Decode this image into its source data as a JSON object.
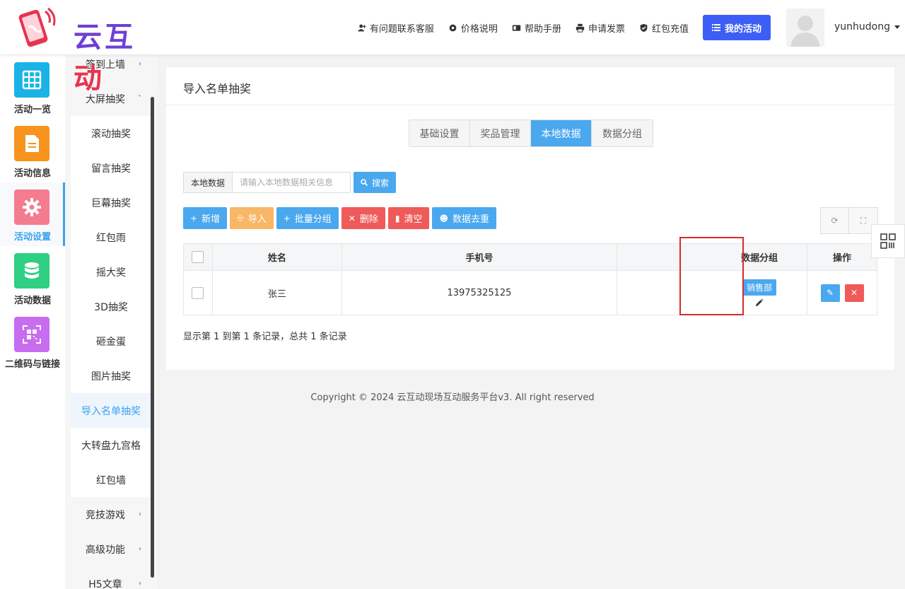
{
  "header": {
    "logo_text_a": "云互",
    "logo_text_b": "动",
    "nav": [
      {
        "label": "有问题联系客服",
        "icon": "user-plus-icon"
      },
      {
        "label": "价格说明",
        "icon": "gear-icon"
      },
      {
        "label": "帮助手册",
        "icon": "book-icon"
      },
      {
        "label": "申请发票",
        "icon": "printer-icon"
      },
      {
        "label": "红包充值",
        "icon": "shield-check-icon"
      }
    ],
    "my_activity_label": "我的活动",
    "username": "yunhudong"
  },
  "iconbar": [
    {
      "label": "活动一览",
      "color": "#19b3e6",
      "icon": "grid-icon"
    },
    {
      "label": "活动信息",
      "color": "#f7941d",
      "icon": "document-icon"
    },
    {
      "label": "活动设置",
      "color": "#f47c8f",
      "icon": "gear-icon",
      "active": true
    },
    {
      "label": "活动数据",
      "color": "#2fcf84",
      "icon": "database-icon"
    },
    {
      "label": "二维码与链接",
      "color": "#c86cf0",
      "icon": "qrcode-icon"
    }
  ],
  "submenu": [
    {
      "label": "签到上墙",
      "parent": true,
      "chev": "›"
    },
    {
      "label": "大屏抽奖",
      "parent": true,
      "chev": "˅"
    },
    {
      "label": "滚动抽奖"
    },
    {
      "label": "留言抽奖"
    },
    {
      "label": "巨幕抽奖"
    },
    {
      "label": "红包雨"
    },
    {
      "label": "摇大奖"
    },
    {
      "label": "3D抽奖"
    },
    {
      "label": "砸金蛋"
    },
    {
      "label": "图片抽奖"
    },
    {
      "label": "导入名单抽奖",
      "active": true
    },
    {
      "label": "大转盘九宫格"
    },
    {
      "label": "红包墙"
    },
    {
      "label": "竞技游戏",
      "parent": true,
      "chev": "›"
    },
    {
      "label": "高级功能",
      "parent": true,
      "chev": "›"
    },
    {
      "label": "H5文章",
      "parent": true,
      "chev": "›"
    }
  ],
  "main": {
    "title": "导入名单抽奖",
    "tabs": [
      "基础设置",
      "奖品管理",
      "本地数据",
      "数据分组"
    ],
    "active_tab": 2,
    "search": {
      "label": "本地数据",
      "placeholder": "请输入本地数据相关信息",
      "button": "搜索"
    },
    "toolbar": [
      {
        "label": "新增",
        "icon": "+",
        "style": "blue"
      },
      {
        "label": "导入",
        "icon": "⎆",
        "style": "orange"
      },
      {
        "label": "批量分组",
        "icon": "+",
        "style": "blue"
      },
      {
        "label": "删除",
        "icon": "✕",
        "style": "red"
      },
      {
        "label": "清空",
        "icon": "▮",
        "style": "red"
      },
      {
        "label": "数据去重",
        "icon": "☻",
        "style": "blue"
      }
    ],
    "table": {
      "columns": [
        "姓名",
        "手机号",
        "数据分组",
        "操作"
      ],
      "rows": [
        {
          "name": "张三",
          "phone": "13975325125",
          "group": "销售部"
        }
      ]
    },
    "pageinfo": "显示第 1 到第 1 条记录，总共 1 条记录"
  },
  "footer": {
    "copyright": "Copyright © 2024 云互动现场互动服务平台v3. All right reserved"
  }
}
